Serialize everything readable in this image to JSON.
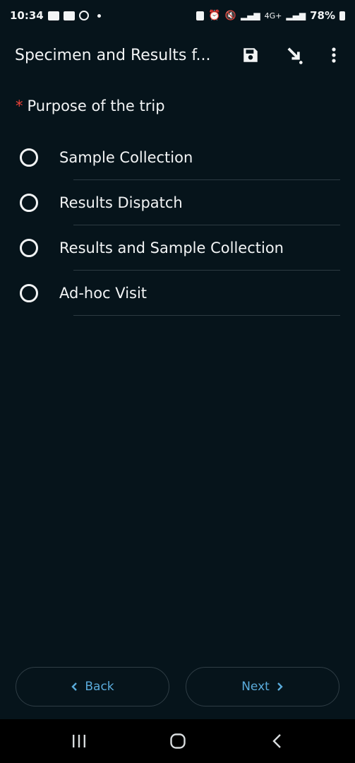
{
  "status_bar": {
    "time": "10:34",
    "network": "4G+",
    "battery": "78%"
  },
  "toolbar": {
    "title": "Specimen and Results f...",
    "save_icon": "save-icon",
    "jump_icon": "go-to-icon",
    "menu_icon": "more-vert-icon"
  },
  "question": {
    "required_mark": "*",
    "label": "Purpose of the trip"
  },
  "options": [
    {
      "label": "Sample Collection",
      "selected": false
    },
    {
      "label": "Results Dispatch",
      "selected": false
    },
    {
      "label": "Results and Sample Collection",
      "selected": false
    },
    {
      "label": "Ad-hoc Visit",
      "selected": false
    }
  ],
  "navigation": {
    "back_label": "Back",
    "next_label": "Next"
  },
  "colors": {
    "background": "#06141b",
    "accent": "#5aabdb",
    "required": "#f0443a"
  }
}
